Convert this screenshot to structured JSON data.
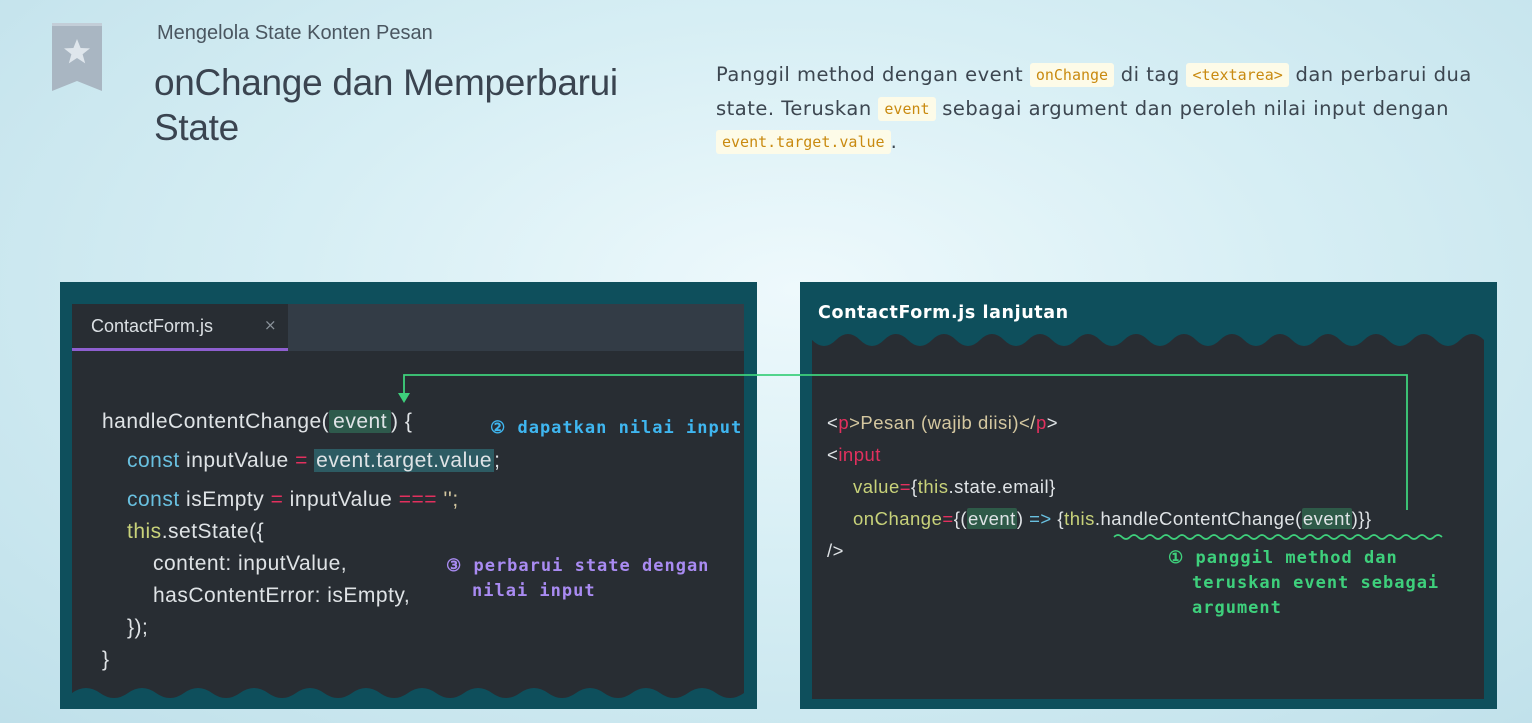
{
  "header": {
    "subtitle": "Mengelola State Konten Pesan",
    "title": "onChange dan Memperbarui State"
  },
  "description": {
    "p1": "Panggil method dengan event ",
    "c1": "onChange",
    "p2": " di tag ",
    "c2": "<textarea>",
    "p3": " dan perbarui dua state. Teruskan ",
    "c3": "event",
    "p4": " sebagai argument dan peroleh nilai input dengan ",
    "c4": "event.target.value",
    "p5": "."
  },
  "left_panel": {
    "tab_label": "ContactForm.js",
    "tab_close": "×",
    "code": {
      "l1a": "handleContentChange(",
      "l1b": "event",
      "l1c": ") {",
      "l2a": "const",
      "l2b": " inputValue ",
      "l2c": "=",
      "l2d": "event.target.value",
      "l2e": ";",
      "l3a": "const",
      "l3b": " isEmpty ",
      "l3c": "=",
      "l3d": " inputValue ",
      "l3e": "===",
      "l3f": " '';",
      "l4a": "this",
      "l4b": ".setState({",
      "l5": "content: inputValue,",
      "l6": "hasContentError: isEmpty,",
      "l7": "});",
      "l8": "}"
    },
    "note2": "② dapatkan nilai input",
    "note3_line1": "③ perbarui state dengan",
    "note3_line2": "nilai input"
  },
  "right_panel": {
    "heading": "ContactForm.js lanjutan",
    "code": {
      "r1a": "<",
      "r1b": "p",
      "r1c": ">Pesan (wajib diisi)</",
      "r1d": "p",
      "r1e": ">",
      "r2a": "<",
      "r2b": "input",
      "r3a": "value",
      "r3b": "=",
      "r3c": "{",
      "r3d": "this",
      "r3e": ".state.email}",
      "r4a": "onChange",
      "r4b": "=",
      "r4c": "{(",
      "r4d": "event",
      "r4e": ") ",
      "r4f": "=>",
      "r4g": " {",
      "r4h": "this",
      "r4i": ".handleContentChange(",
      "r4j": "event",
      "r4k": ")}}",
      "r5": "/>"
    },
    "note1_line1": "① panggil method dan",
    "note1_line2": "teruskan event sebagai",
    "note1_line3": "argument"
  },
  "colors": {
    "panel": "#0e4f5c",
    "editor": "#282d33",
    "tab_accent": "#8e5fd0",
    "note_cyan": "#3fb6f0",
    "note_purple": "#a98bf2",
    "note_green": "#3ed07c"
  }
}
